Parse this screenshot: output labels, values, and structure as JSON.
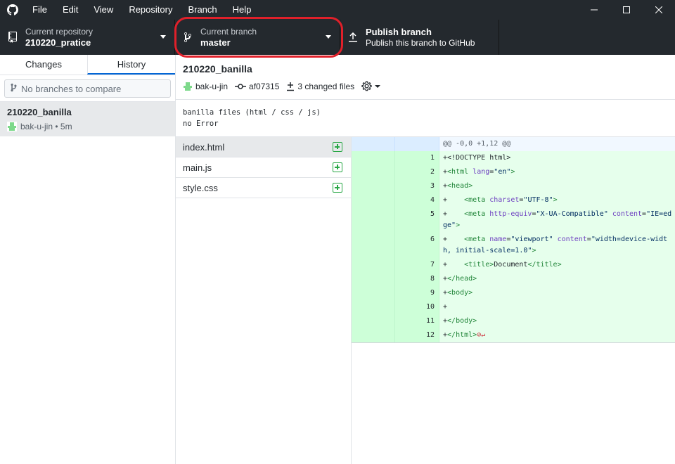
{
  "menu": [
    "File",
    "Edit",
    "View",
    "Repository",
    "Branch",
    "Help"
  ],
  "toolbar": {
    "repo_label": "Current repository",
    "repo_name": "210220_pratice",
    "branch_label": "Current branch",
    "branch_name": "master",
    "publish_title": "Publish branch",
    "publish_sub": "Publish this branch to GitHub"
  },
  "sidebar": {
    "tab_changes": "Changes",
    "tab_history": "History",
    "compare_placeholder": "No branches to compare",
    "commit": {
      "title": "210220_banilla",
      "meta": "bak-u-jin • 5m"
    }
  },
  "commit": {
    "title": "210220_banilla",
    "author": "bak-u-jin",
    "sha": "af07315",
    "changed": "3 changed files",
    "description": [
      "banilla files (html / css / js)",
      "no Error"
    ]
  },
  "files": [
    "index.html",
    "main.js",
    "style.css"
  ],
  "diff": {
    "hunk": "@@ -0,0 +1,12 @@",
    "lines": [
      "1",
      "2",
      "3",
      "4",
      "5",
      "6",
      "7",
      "8",
      "9",
      "10",
      "11",
      "12"
    ]
  },
  "icons": {
    "logo": "github-icon",
    "repo": "repo-icon",
    "branch": "branch-icon",
    "publish": "upload-icon"
  },
  "colors": {
    "accent": "#0366d6",
    "add": "#28a745",
    "highlight": "#e0202a"
  }
}
